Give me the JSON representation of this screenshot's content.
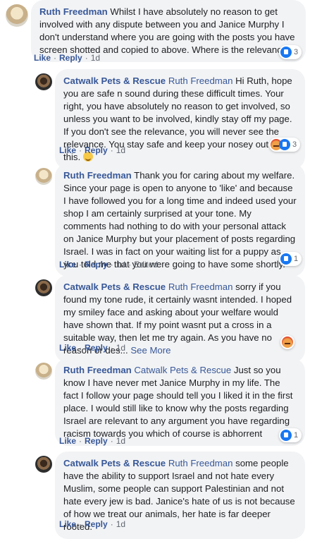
{
  "comments": [
    {
      "author": "Ruth Freedman",
      "text": "Whilst I have absolutely no reason to get involved with any dispute between you and Janice Murphy I don't understand where you are going with the posts you have screen shotted and copied to above. Where is the relevance?",
      "like": "Like",
      "reply": "Reply",
      "time": "1d",
      "reaction_count": "3"
    },
    {
      "author": "Catwalk Pets & Rescue",
      "mention": "Ruth Freedman",
      "text": "Hi Ruth, hope you are safe n sound during these difficult times. Your right, you have absolutely no reason to get involved, so unless you want to be involved, kindly stay off my page. If you don't see the relevance, you will never see the relevance. You stay safe and keep your nosey out of this.",
      "like": "Like",
      "reply": "Reply",
      "time": "1d",
      "reaction_count": "3"
    },
    {
      "author": "Ruth Freedman",
      "text": "Thank you for caring about my welfare. Since your page is open to anyone to 'like' and because I have followed you for a long time and indeed used your shop I am certainly surprised at your tone. My comments had nothing to do with your personal attack on Janice Murphy but your placement of posts regarding Israel. I was in fact on your waiting list for a puppy as you told me that you were going to have some shortly.",
      "like": "Like",
      "reply": "Reply",
      "time": "1d",
      "edited": "Edited",
      "reaction_count": "1"
    },
    {
      "author": "Catwalk Pets & Rescue",
      "mention": "Ruth Freedman",
      "text": "sorry if you found my tone rude, it certainly wasnt intended. I hoped my smiley face and asking about your welfare would have shown that. If my point wasnt put a cross in a suitable way, then let me try again. As you have no reason or des...",
      "see_more": "See More",
      "like": "Like",
      "reply": "Reply",
      "time": "1d"
    },
    {
      "author": "Ruth Freedman",
      "mention": "Catwalk Pets & Rescue",
      "text": "Just so you know I have never met Janice Murphy in my life. The fact I follow your page should tell you I liked it in the first place. I would still like to know why the posts regarding Israel are relevant to any argument you have regarding racism towards you which of course is abhorrent",
      "like": "Like",
      "reply": "Reply",
      "time": "1d",
      "reaction_count": "1"
    },
    {
      "author": "Catwalk Pets & Rescue",
      "mention": "Ruth Freedman",
      "text": "some people have the ability to support Israel and not hate every Muslim, some people can support Palestinian and not hate every jew is bad. Janice's hate of us is not because of how we treat our animals, her hate is far deeper rooted.",
      "like": "Like",
      "reply": "Reply",
      "time": "1d"
    }
  ]
}
